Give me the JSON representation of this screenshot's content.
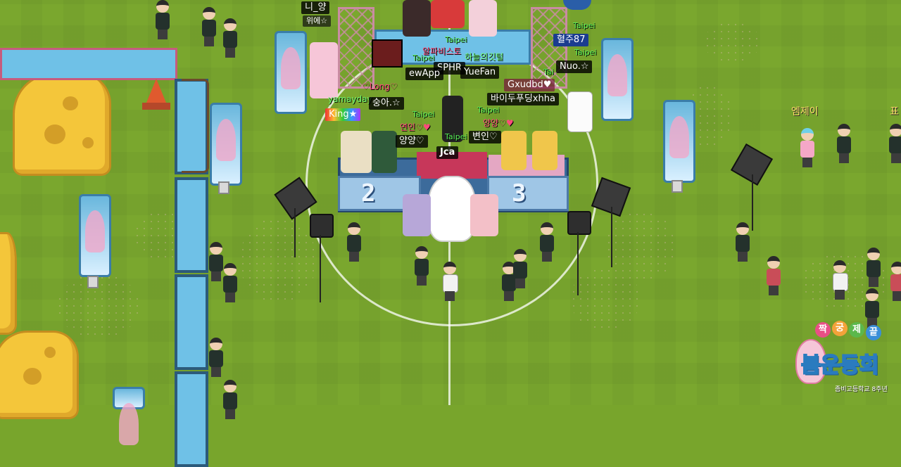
{
  "scene": {
    "title": "Zombie High School Spring Sports Day",
    "colors": {
      "grass": "#7aa72e",
      "tag_bg": "#141414",
      "guild_text": "#5af15a",
      "accent_pink": "#ff4b7a",
      "logo_blue": "#2a7bbf"
    }
  },
  "stage": {
    "second_place_label": "2",
    "third_place_label": "3"
  },
  "players": {
    "top_center": {
      "name": "니_양",
      "title": "위에☆"
    },
    "hyeolju": {
      "name": "혈주87",
      "guild": "Taipei"
    },
    "nuo": {
      "name": "Nuo.☆",
      "guild": "Taipei"
    },
    "sphr": {
      "name": "SPHR",
      "guild": "Taipei"
    },
    "yuefan": {
      "name": "YueFan",
      "guild": "Taipei"
    },
    "ewapp": {
      "name": "ewApp",
      "guild": "Taipei"
    },
    "long": {
      "name": "♡Long♡"
    },
    "hanul": {
      "name": "하늘의깃털"
    },
    "alpa": {
      "name": "알파비스토"
    },
    "gxudbd": {
      "name": "Gxudbd♥",
      "guild": "Tai"
    },
    "baidu": {
      "name": "바이두푸딩xhha"
    },
    "yamayda": {
      "name": "yamayday"
    },
    "king": {
      "name": "King★"
    },
    "suna": {
      "name": "숭아.☆"
    },
    "yeonin": {
      "name": "연인♡♥",
      "guild": "Taipei"
    },
    "yangyang_small": {
      "name": "양양♡♥",
      "guild": "Taipei"
    },
    "yangyang": {
      "name": "양양♡"
    },
    "byeonin": {
      "name": "변인♡",
      "guild": "Taipei"
    },
    "jca": {
      "name": "Jca"
    },
    "mj": {
      "name": "엠제이"
    },
    "pyo": {
      "name": "표"
    }
  },
  "logo": {
    "circles": [
      "짝",
      "궁",
      "제",
      "끝"
    ],
    "main_text": "봄운동회",
    "subtitle": "좀비고등학교 8주년"
  }
}
